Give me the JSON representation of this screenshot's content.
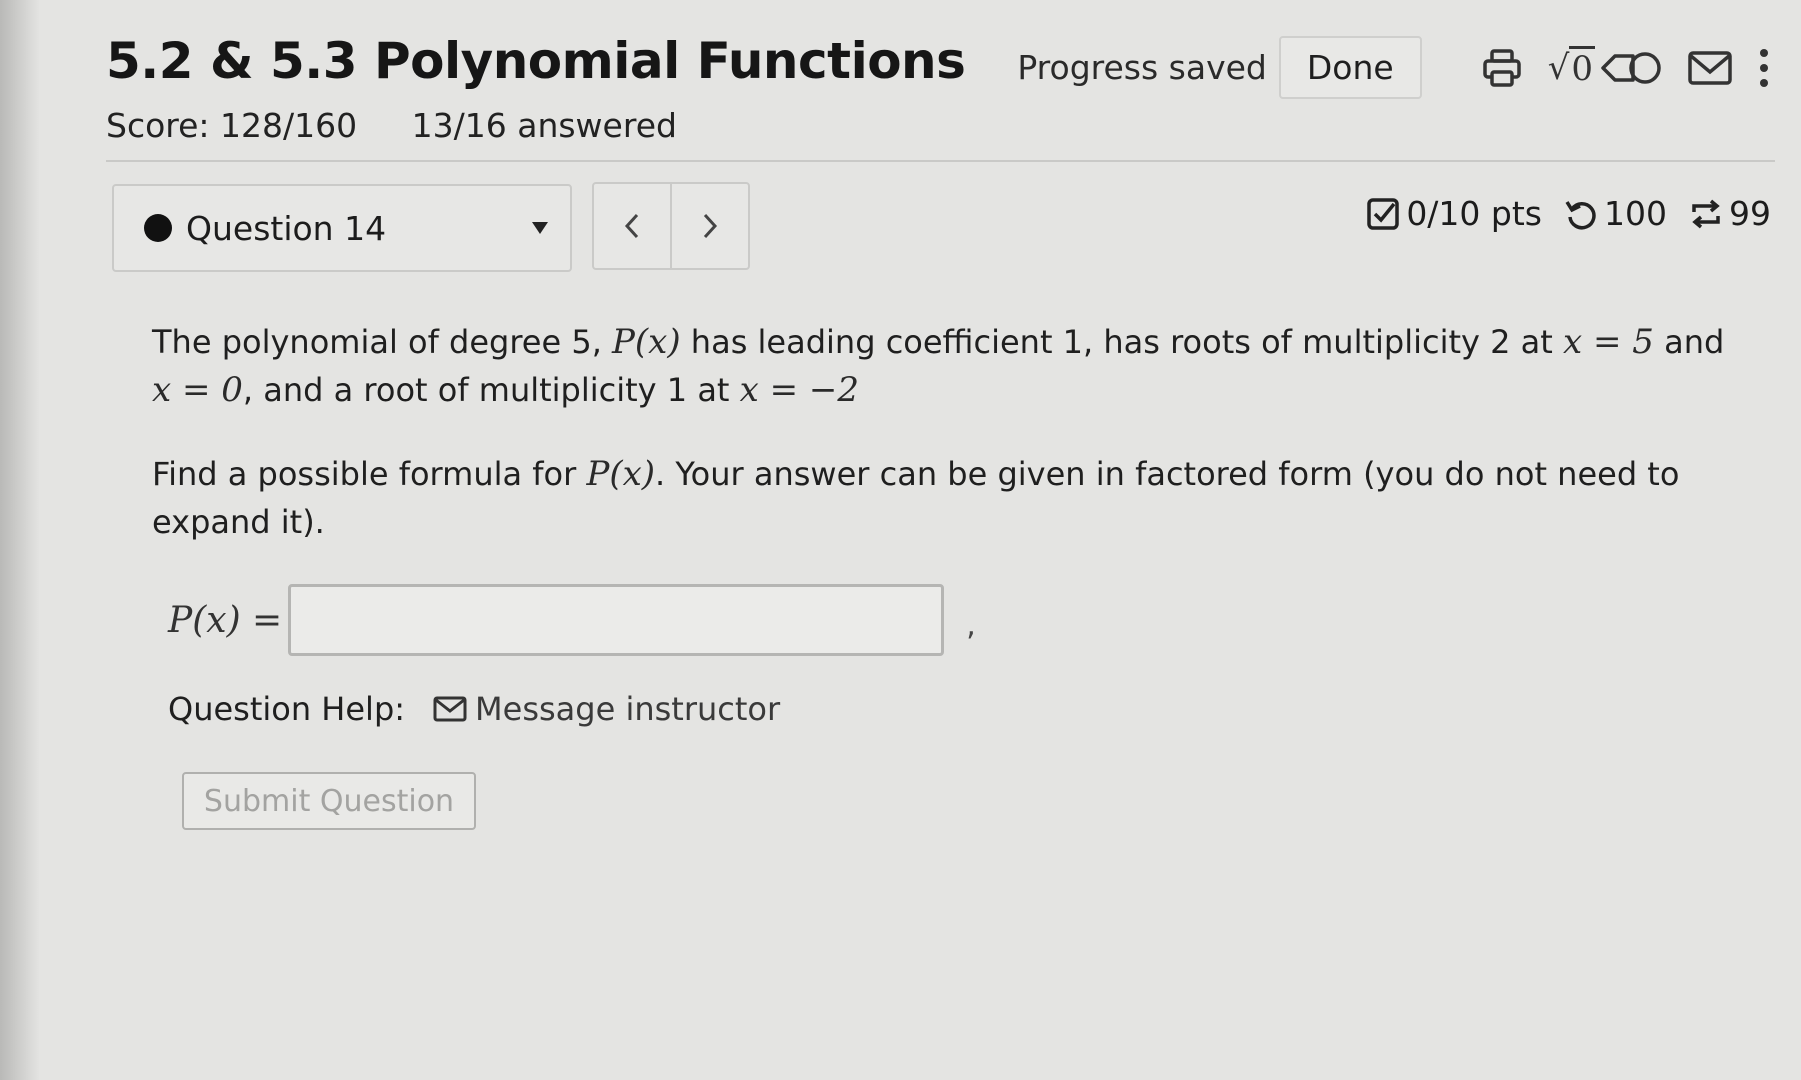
{
  "header": {
    "title": "5.2 & 5.3 Polynomial Functions",
    "score": "Score: 128/160",
    "answered": "13/16 answered",
    "progress_saved": "Progress saved",
    "done_label": "Done",
    "sqrt_symbol": "√",
    "sqrt_box": "0",
    "icons": [
      "print-icon",
      "math-entry-icon",
      "tag-icon",
      "mail-icon",
      "more-vertical-icon"
    ]
  },
  "question_nav": {
    "current": "Question 14",
    "prev_symbol": "<",
    "next_symbol": ">"
  },
  "stats": {
    "points": "0/10 pts",
    "attempts": "100",
    "versions": "99"
  },
  "question": {
    "p1_a": "The polynomial of degree 5, ",
    "p1_math1": "P(x)",
    "p1_b": " has leading coefficient 1, has roots of multiplicity 2 at ",
    "p1_math2": "x = 5",
    "p1_c": " and",
    "p1_math3": "x = 0",
    "p1_d": ", and a root of multiplicity 1 at ",
    "p1_math4": "x = −2",
    "p2_a": "Find a possible formula for ",
    "p2_math": "P(x)",
    "p2_b": ". Your answer can be given in factored form (you do not need to expand it)."
  },
  "answer": {
    "label": "P(x) =",
    "value": "",
    "comma": ","
  },
  "help": {
    "label": "Question Help:",
    "message_link": "Message instructor"
  },
  "submit_label": "Submit Question",
  "colors": {
    "background": "#e4e4e2",
    "text": "#1f1f1f",
    "disabled_text": "#a3a3a1"
  }
}
